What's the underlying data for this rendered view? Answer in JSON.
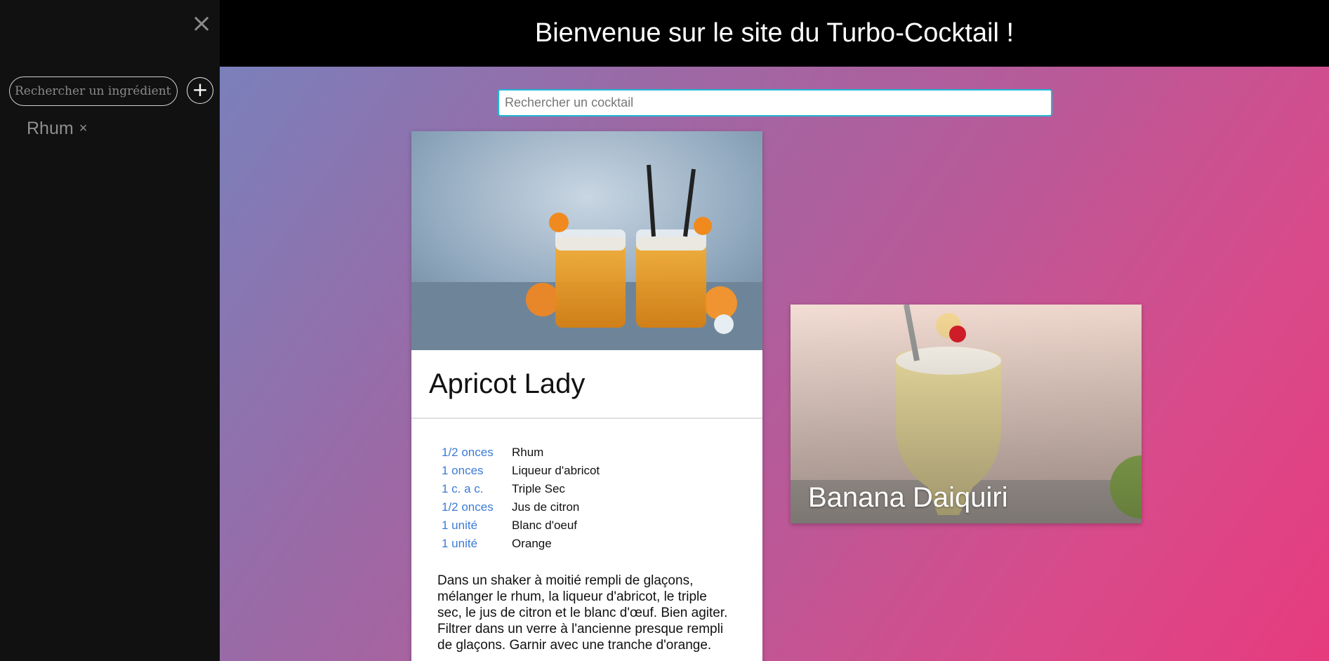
{
  "header": {
    "title": "Bienvenue sur le site du Turbo-Cocktail !"
  },
  "sidebar": {
    "close_label": "×",
    "ingredient_search_placeholder": "Rechercher un ingrédient",
    "add_label": "+",
    "tags": [
      {
        "label": "Rhum",
        "remove": "×"
      }
    ]
  },
  "main": {
    "search_placeholder": "Rechercher un cocktail",
    "cocktails": [
      {
        "name": "Apricot Lady",
        "ingredients": [
          {
            "qty": "1/2 onces",
            "name": "Rhum"
          },
          {
            "qty": "1 onces",
            "name": "Liqueur d'abricot"
          },
          {
            "qty": "1 c. a c.",
            "name": "Triple Sec"
          },
          {
            "qty": "1/2 onces",
            "name": "Jus de citron"
          },
          {
            "qty": "1 unité",
            "name": "Blanc d'oeuf"
          },
          {
            "qty": "1 unité",
            "name": "Orange"
          }
        ],
        "recipe": "Dans un shaker à moitié rempli de glaçons, mélanger le rhum, la liqueur d'abricot, le triple sec, le jus de citron et le blanc d'œuf. Bien agiter. Filtrer dans un verre à l'ancienne presque rempli de glaçons. Garnir avec une tranche d'orange."
      },
      {
        "name": "Banana Daiquiri"
      }
    ]
  },
  "colors": {
    "accent": "#22b8d4",
    "quantity": "#3b7bd6",
    "sidebar_bg": "#111111"
  }
}
